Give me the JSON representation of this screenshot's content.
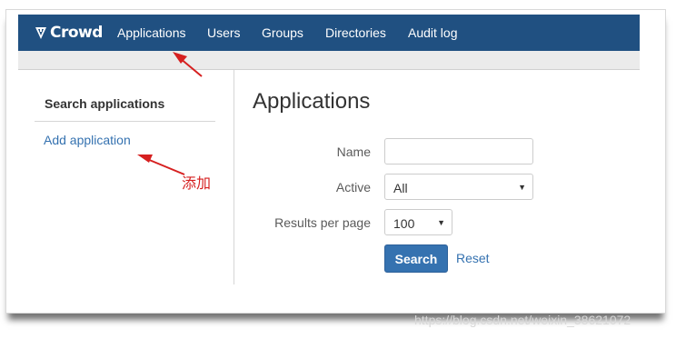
{
  "navbar": {
    "logo_text": "Crowd",
    "items": [
      {
        "label": "Applications"
      },
      {
        "label": "Users"
      },
      {
        "label": "Groups"
      },
      {
        "label": "Directories"
      },
      {
        "label": "Audit log"
      }
    ]
  },
  "sidebar": {
    "heading": "Search applications",
    "add_link": "Add application"
  },
  "main": {
    "title": "Applications",
    "form": {
      "name_label": "Name",
      "name_value": "",
      "active_label": "Active",
      "active_value": "All",
      "results_label": "Results per page",
      "results_value": "100",
      "search_button": "Search",
      "reset_link": "Reset"
    }
  },
  "annotation": {
    "text": "添加",
    "color": "#d62020"
  },
  "watermark": "https://blog.csdn.net/weixin_38621072",
  "colors": {
    "navbar_bg": "#205081",
    "link": "#3572b0",
    "button_bg": "#3572b0",
    "annotation_red": "#d62020"
  }
}
